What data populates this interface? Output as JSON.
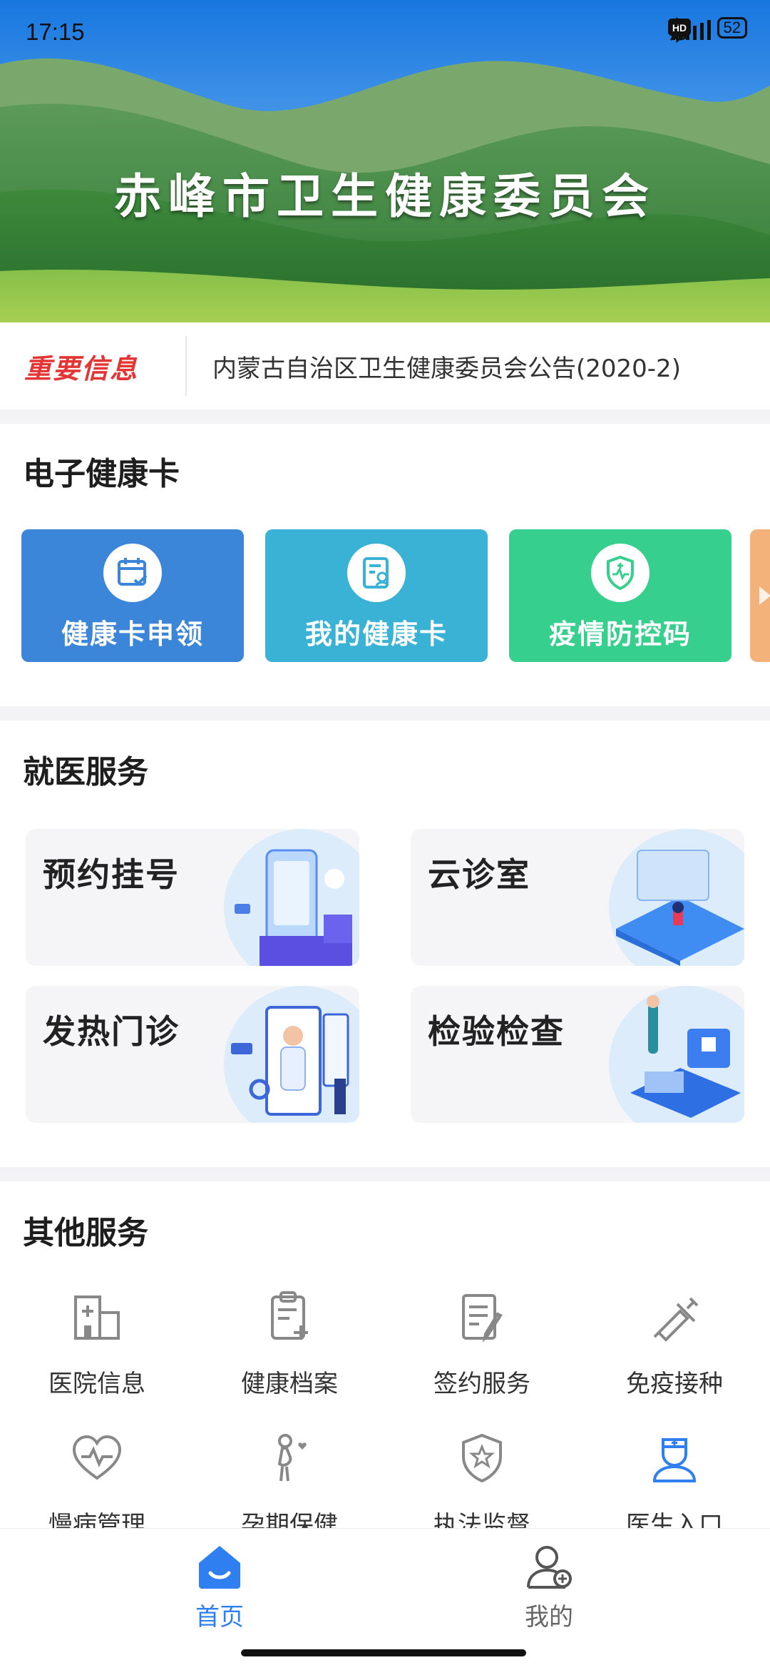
{
  "status": {
    "time": "17:15",
    "battery": "52",
    "network": "4G"
  },
  "banner": {
    "title": "赤峰市卫生健康委员会"
  },
  "notice": {
    "tag": "重要信息",
    "text": "内蒙古自治区卫生健康委员会公告(2020-2)"
  },
  "health_card": {
    "title": "电子健康卡",
    "items": [
      {
        "label": "健康卡申领",
        "icon": "calendar-check-icon",
        "color": "#3b86d8"
      },
      {
        "label": "我的健康卡",
        "icon": "id-card-icon",
        "color": "#39b2d6"
      },
      {
        "label": "疫情防控码",
        "icon": "shield-heartbeat-icon",
        "color": "#36cf8d"
      }
    ]
  },
  "medical": {
    "title": "就医服务",
    "items": [
      {
        "label": "预约挂号",
        "icon": "phone-appointment-illustration"
      },
      {
        "label": "云诊室",
        "icon": "cloud-clinic-illustration"
      },
      {
        "label": "发热门诊",
        "icon": "doctor-consult-illustration"
      },
      {
        "label": "检验检查",
        "icon": "lab-test-illustration"
      }
    ]
  },
  "other": {
    "title": "其他服务",
    "items": [
      {
        "label": "医院信息",
        "icon": "hospital-icon"
      },
      {
        "label": "健康档案",
        "icon": "clipboard-plus-icon"
      },
      {
        "label": "签约服务",
        "icon": "document-sign-icon"
      },
      {
        "label": "免疫接种",
        "icon": "syringe-icon"
      },
      {
        "label": "慢病管理",
        "icon": "heart-pulse-icon"
      },
      {
        "label": "孕期保健",
        "icon": "pregnant-icon"
      },
      {
        "label": "执法监督",
        "icon": "shield-star-icon"
      },
      {
        "label": "医生入口",
        "icon": "doctor-icon"
      }
    ]
  },
  "nav": {
    "items": [
      {
        "label": "首页",
        "icon": "home-icon",
        "active": true
      },
      {
        "label": "我的",
        "icon": "user-icon",
        "active": false
      }
    ]
  },
  "colors": {
    "accent": "#2f7ff0",
    "notice_tag": "#e43535",
    "inactive": "#666666"
  }
}
